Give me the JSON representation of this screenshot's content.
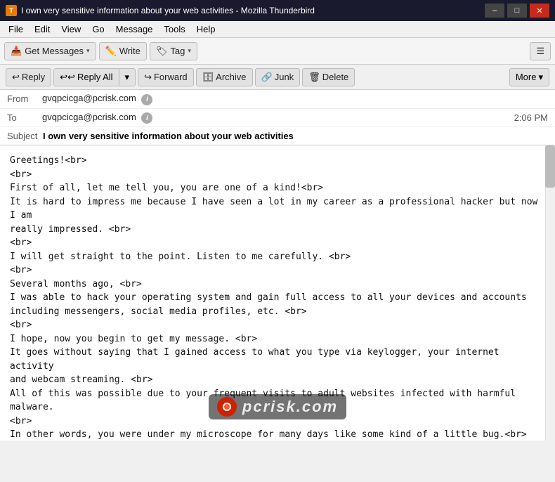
{
  "window": {
    "title": "I own very sensitive information about your web activities - Mozilla Thunderbird",
    "controls": [
      "–",
      "□",
      "✕"
    ]
  },
  "menubar": {
    "items": [
      "File",
      "Edit",
      "View",
      "Go",
      "Message",
      "Tools",
      "Help"
    ]
  },
  "toolbar": {
    "get_messages_label": "Get Messages",
    "write_label": "Write",
    "tag_label": "Tag"
  },
  "action_bar": {
    "reply_label": "Reply",
    "reply_all_label": "Reply All",
    "forward_label": "Forward",
    "archive_label": "Archive",
    "junk_label": "Junk",
    "delete_label": "Delete",
    "more_label": "More"
  },
  "email_header": {
    "from_label": "From",
    "from_value": "gvqpcicga@pcrisk.com",
    "to_label": "To",
    "to_value": "gvqpcicga@pcrisk.com",
    "time": "2:06 PM",
    "subject_label": "Subject",
    "subject_value": "I own very sensitive information about your web activities"
  },
  "email_body": {
    "content": "Greetings!<br>\n<br>\nFirst of all, let me tell you, you are one of a kind!<br>\nIt is hard to impress me because I have seen a lot in my career as a professional hacker but now I am\nreally impressed. <br>\n<br>\nI will get straight to the point. Listen to me carefully. <br>\n<br>\nSeveral months ago, <br>\nI was able to hack your operating system and gain full access to all your devices and accounts\nincluding messengers, social media profiles, etc. <br>\n<br>\nI hope, now you begin to get my message. <br>\nIt goes without saying that I gained access to what you type via keylogger, your internet activity\nand webcam streaming. <br>\nAll of this was possible due to your frequent visits to adult websites infected with harmful malware.\n<br>\nIn other words, you were under my microscope for many days like some kind of a little bug.<br>\nThe only difference is that unlike you there is no bug in the world who like to watch pervert porn.\n<br>\n<br>\nYes, you understand it right: I was able to see everything on your screen and record video and audio\nstreams of your camera and microphone. <br>\nAll of these records are currently securely saved on my storage as well as a backup copy. <br>\n<br>\nIn addition, I also gained access to your confidential information contained in your emails and chat\nmessages.<br>\n<br>\nIf you are wondering why your antivirus and spyware defender software allowed me to do all of\nthis: <br>\n()"
  },
  "watermark": {
    "text": "pcrisk.com"
  }
}
